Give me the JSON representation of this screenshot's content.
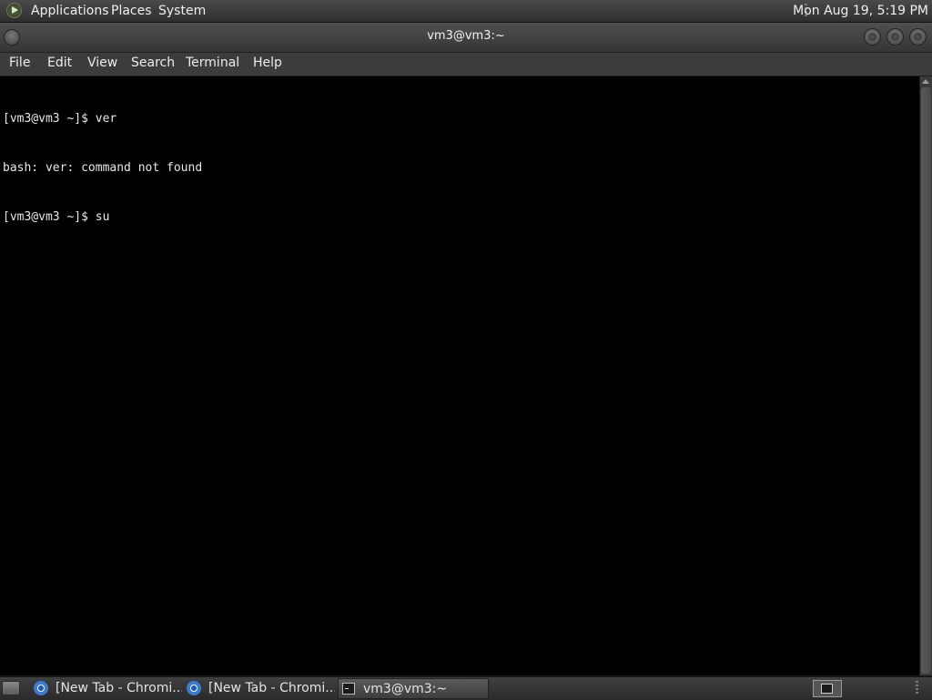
{
  "top_panel": {
    "menus": [
      "Applications",
      "Places",
      "System"
    ],
    "clock": "Mon Aug 19,  5:19 PM"
  },
  "window": {
    "title": "vm3@vm3:~",
    "menubar": [
      "File",
      "Edit",
      "View",
      "Search",
      "Terminal",
      "Help"
    ]
  },
  "terminal": {
    "lines": [
      "[vm3@vm3 ~]$ ver",
      "bash: ver: command not found",
      "[vm3@vm3 ~]$ su"
    ]
  },
  "taskbar": {
    "tasks": [
      {
        "label": "[New Tab - Chromi...",
        "icon": "chromium-icon"
      },
      {
        "label": "[New Tab - Chromi...",
        "icon": "chromium-icon"
      },
      {
        "label": "vm3@vm3:~",
        "icon": "terminal-icon",
        "active": true
      }
    ]
  }
}
